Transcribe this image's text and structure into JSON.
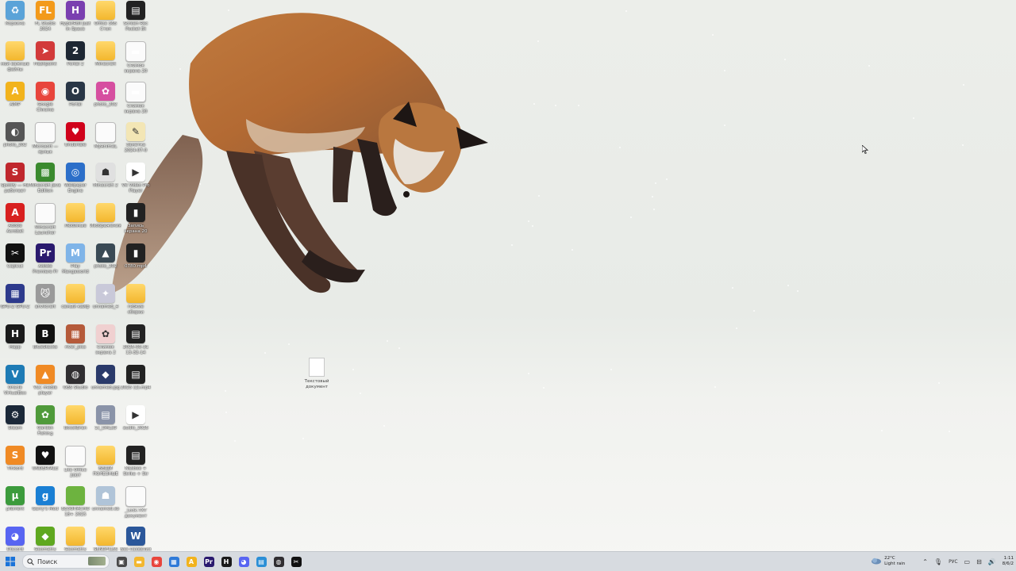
{
  "desktop_icons": [
    {
      "label": "Корзина",
      "icon": "recycle-bin-icon",
      "color": "#5aa3d8",
      "glyph": "♻"
    },
    {
      "label": "FL Studio 2024",
      "icon": "fl-studio-icon",
      "color": "#f39a1a",
      "glyph": "FL"
    },
    {
      "label": "HyperRoll Just In Space",
      "icon": "game-icon",
      "color": "#7a3fb0",
      "glyph": "H"
    },
    {
      "label": "Office 365 Стоп",
      "icon": "folder-icon",
      "color": "folder",
      "glyph": ""
    },
    {
      "label": "Screen Rec Pocket Bt",
      "icon": "video-file-icon",
      "color": "film",
      "glyph": "▤"
    },
    {
      "label": "мой важные файлы",
      "icon": "folder-icon",
      "color": "folder",
      "glyph": ""
    },
    {
      "label": "Flashpoint",
      "icon": "flashpoint-icon",
      "color": "#d23a3a",
      "glyph": "➤"
    },
    {
      "label": "Portal 2",
      "icon": "portal-icon",
      "color": "#1d2733",
      "glyph": "2"
    },
    {
      "label": "Minecraft",
      "icon": "folder-icon",
      "color": "folder",
      "glyph": ""
    },
    {
      "label": "Снимок экрана 20",
      "icon": "image-file-icon",
      "color": "doc",
      "glyph": "▬"
    },
    {
      "label": "AIMP",
      "icon": "aimp-icon",
      "color": "#f2b31c",
      "glyph": "A"
    },
    {
      "label": "Google Chrome",
      "icon": "chrome-icon",
      "color": "#e8453c",
      "glyph": "◉"
    },
    {
      "label": "Portal",
      "icon": "portal-icon",
      "color": "#293646",
      "glyph": "O"
    },
    {
      "label": "photo_202",
      "icon": "image-file-icon",
      "color": "#d64fa0",
      "glyph": "✿"
    },
    {
      "label": "Снимок экрана 20",
      "icon": "image-file-icon",
      "color": "doc",
      "glyph": "▬"
    },
    {
      "label": "photo_202",
      "icon": "image-file-icon",
      "color": "#555",
      "glyph": "◐"
    },
    {
      "label": "Microsoft — ярлык",
      "icon": "doc-file-icon",
      "color": "doc",
      "glyph": ""
    },
    {
      "label": "Undertale",
      "icon": "heart-icon",
      "color": "#d0021b",
      "glyph": "♥"
    },
    {
      "label": "MyAnimeL",
      "icon": "doc-file-icon",
      "color": "doc",
      "glyph": ""
    },
    {
      "label": "Заметка 2024-07-0",
      "icon": "note-file-icon",
      "color": "#f3e6b5",
      "glyph": "✎"
    },
    {
      "label": "Spotify — Не работает",
      "icon": "app-icon",
      "color": "#c0272d",
      "glyph": "S"
    },
    {
      "label": "Minecraft Java Edition",
      "icon": "minecraft-icon",
      "color": "#3a8a2e",
      "glyph": "▩"
    },
    {
      "label": "Wallpaper Engine",
      "icon": "wallpaper-engine-icon",
      "color": "#2c6fc9",
      "glyph": "◎"
    },
    {
      "label": "Minecraft 2",
      "icon": "app-icon",
      "color": "#e0e0e0",
      "glyph": "☗"
    },
    {
      "label": "VK Video Pro Player",
      "icon": "video-icon",
      "color": "#ffffff",
      "glyph": "▶"
    },
    {
      "label": "Adobe Acrobat",
      "icon": "acrobat-icon",
      "color": "#d8201f",
      "glyph": "A"
    },
    {
      "label": "Minecraft Launcher",
      "icon": "doc-file-icon",
      "color": "doc",
      "glyph": ""
    },
    {
      "label": "Любимые",
      "icon": "folder-icon",
      "color": "folder",
      "glyph": ""
    },
    {
      "label": "Изображения",
      "icon": "folder-icon",
      "color": "folder",
      "glyph": ""
    },
    {
      "label": "Запись экрана 20",
      "icon": "video-file-icon",
      "color": "film",
      "glyph": "▮"
    },
    {
      "label": "CapCut",
      "icon": "capcut-icon",
      "color": "#111111",
      "glyph": "✂"
    },
    {
      "label": "Adobe Premiere Pr",
      "icon": "premiere-icon",
      "color": "#2a1a6e",
      "glyph": "Pr"
    },
    {
      "label": "Play Mangaworld",
      "icon": "app-icon",
      "color": "#7fb4e8",
      "glyph": "M"
    },
    {
      "label": "photo_202",
      "icon": "image-file-icon",
      "color": "#3a4a55",
      "glyph": "▲"
    },
    {
      "label": "0780.mp4",
      "icon": "video-file-icon",
      "color": "film",
      "glyph": "▮"
    },
    {
      "label": "GPU-Z GPU-Z",
      "icon": "gpuz-icon",
      "color": "#2d3a8c",
      "glyph": "▦"
    },
    {
      "label": "anvilcraft",
      "icon": "cat-icon",
      "color": "#9a9a9a",
      "glyph": "😼"
    },
    {
      "label": "самый кайф",
      "icon": "folder-icon",
      "color": "folder",
      "glyph": ""
    },
    {
      "label": "unnamed_4",
      "icon": "image-file-icon",
      "color": "#c9c9d9",
      "glyph": "✦"
    },
    {
      "label": "гибкие сборки",
      "icon": "folder-icon",
      "color": "folder",
      "glyph": ""
    },
    {
      "label": "Happ",
      "icon": "happ-icon",
      "color": "#1a1a1a",
      "glyph": "H"
    },
    {
      "label": "BlueStacks",
      "icon": "bluestacks-icon",
      "color": "#111111",
      "glyph": "B"
    },
    {
      "label": "river_pics",
      "icon": "folder-icon",
      "color": "#b55a3a",
      "glyph": "▦"
    },
    {
      "label": "Снимок экрана 2",
      "icon": "image-file-icon",
      "color": "#f0d0d0",
      "glyph": "✿"
    },
    {
      "label": "2025-03-31 13-32-14",
      "icon": "video-file-icon",
      "color": "film",
      "glyph": "▤"
    },
    {
      "label": "Oracle VirtualBox",
      "icon": "virtualbox-icon",
      "color": "#1e7bb5",
      "glyph": "V"
    },
    {
      "label": "VLC media player",
      "icon": "vlc-icon",
      "color": "#f08a24",
      "glyph": "▲"
    },
    {
      "label": "OBS Studio",
      "icon": "obs-icon",
      "color": "#302e31",
      "glyph": "◍"
    },
    {
      "label": "unnamed.jpg",
      "icon": "image-file-icon",
      "color": "#2a3a6a",
      "glyph": "◆"
    },
    {
      "label": "2025 (2).mp4",
      "icon": "video-file-icon",
      "color": "film",
      "glyph": "▤"
    },
    {
      "label": "Steam",
      "icon": "steam-icon",
      "color": "#1b2838",
      "glyph": "⚙"
    },
    {
      "label": "Garden Fishing",
      "icon": "game-icon",
      "color": "#4f9a3a",
      "glyph": "✿"
    },
    {
      "label": "BoostBran",
      "icon": "folder-icon",
      "color": "folder",
      "glyph": ""
    },
    {
      "label": "1c_DHLa9",
      "icon": "image-file-icon",
      "color": "#8a93a8",
      "glyph": "▤"
    },
    {
      "label": "audio_2025",
      "icon": "audio-file-icon",
      "color": "#ffffff",
      "glyph": "▶"
    },
    {
      "label": "Tinkord",
      "icon": "app-icon",
      "color": "#f08a24",
      "glyph": "S"
    },
    {
      "label": "UNDERTALE",
      "icon": "undertale-icon",
      "color": "#111111",
      "glyph": "♥"
    },
    {
      "label": "Lite Office 2007",
      "icon": "doc-file-icon",
      "color": "doc",
      "glyph": ""
    },
    {
      "label": "ВЕЩИ ПОЛЕЗНЫЕ",
      "icon": "folder-icon",
      "color": "folder",
      "glyph": ""
    },
    {
      "label": "Nasbee + Strike + Str",
      "icon": "video-file-icon",
      "color": "film",
      "glyph": "▤"
    },
    {
      "label": "µTorrent",
      "icon": "utorrent-icon",
      "color": "#3c9b3c",
      "glyph": "µ"
    },
    {
      "label": "Garry's Mod",
      "icon": "gmod-icon",
      "color": "#1a7fd4",
      "glyph": "g"
    },
    {
      "label": "БЕЗОПАСНО 18+ 2025",
      "icon": "folder-icon",
      "color": "#6db33f",
      "glyph": ""
    },
    {
      "label": "unnamed.sb",
      "icon": "image-file-icon",
      "color": "#b0c4d8",
      "glyph": "☗"
    },
    {
      "label": "_Lock.ТХТ документ",
      "icon": "doc-file-icon",
      "color": "doc",
      "glyph": ""
    },
    {
      "label": "Discord",
      "icon": "discord-icon",
      "color": "#5865f2",
      "glyph": "◕"
    },
    {
      "label": "Geometry Dash",
      "icon": "geometry-dash-icon",
      "color": "#5fa81f",
      "glyph": "◆"
    },
    {
      "label": "Geometry Dash 2.2",
      "icon": "folder-icon",
      "color": "folder",
      "glyph": ""
    },
    {
      "label": "SENDFILES",
      "icon": "folder-icon",
      "color": "folder",
      "glyph": ""
    },
    {
      "label": "Без названия",
      "icon": "word-icon",
      "color": "#2b579a",
      "glyph": "W"
    }
  ],
  "desktop_loose_file": {
    "label": "Текстовый документ"
  },
  "taskbar": {
    "search_placeholder": "Поиск",
    "apps": [
      {
        "icon": "task-view-icon",
        "color": "#4a4a4a",
        "glyph": "▣"
      },
      {
        "icon": "file-explorer-icon",
        "color": "#f3b72e",
        "glyph": "▬"
      },
      {
        "icon": "chrome-icon",
        "color": "#e8453c",
        "glyph": "◉"
      },
      {
        "icon": "store-icon",
        "color": "#2f7ad8",
        "glyph": "▦"
      },
      {
        "icon": "aimp-icon",
        "color": "#f2b31c",
        "glyph": "A"
      },
      {
        "icon": "premiere-icon",
        "color": "#2a1a6e",
        "glyph": "Pr"
      },
      {
        "icon": "happ-icon",
        "color": "#1a1a1a",
        "glyph": "H"
      },
      {
        "icon": "discord-icon",
        "color": "#5865f2",
        "glyph": "◕"
      },
      {
        "icon": "notepad-icon",
        "color": "#2b8fd6",
        "glyph": "▤"
      },
      {
        "icon": "obs-icon",
        "color": "#302e31",
        "glyph": "◍"
      },
      {
        "icon": "capcut-icon",
        "color": "#111111",
        "glyph": "✂"
      }
    ]
  },
  "tray": {
    "temperature": "22°C",
    "weather": "Light rain",
    "language": "РУС",
    "time": "1:11",
    "date": "8/6/2"
  }
}
